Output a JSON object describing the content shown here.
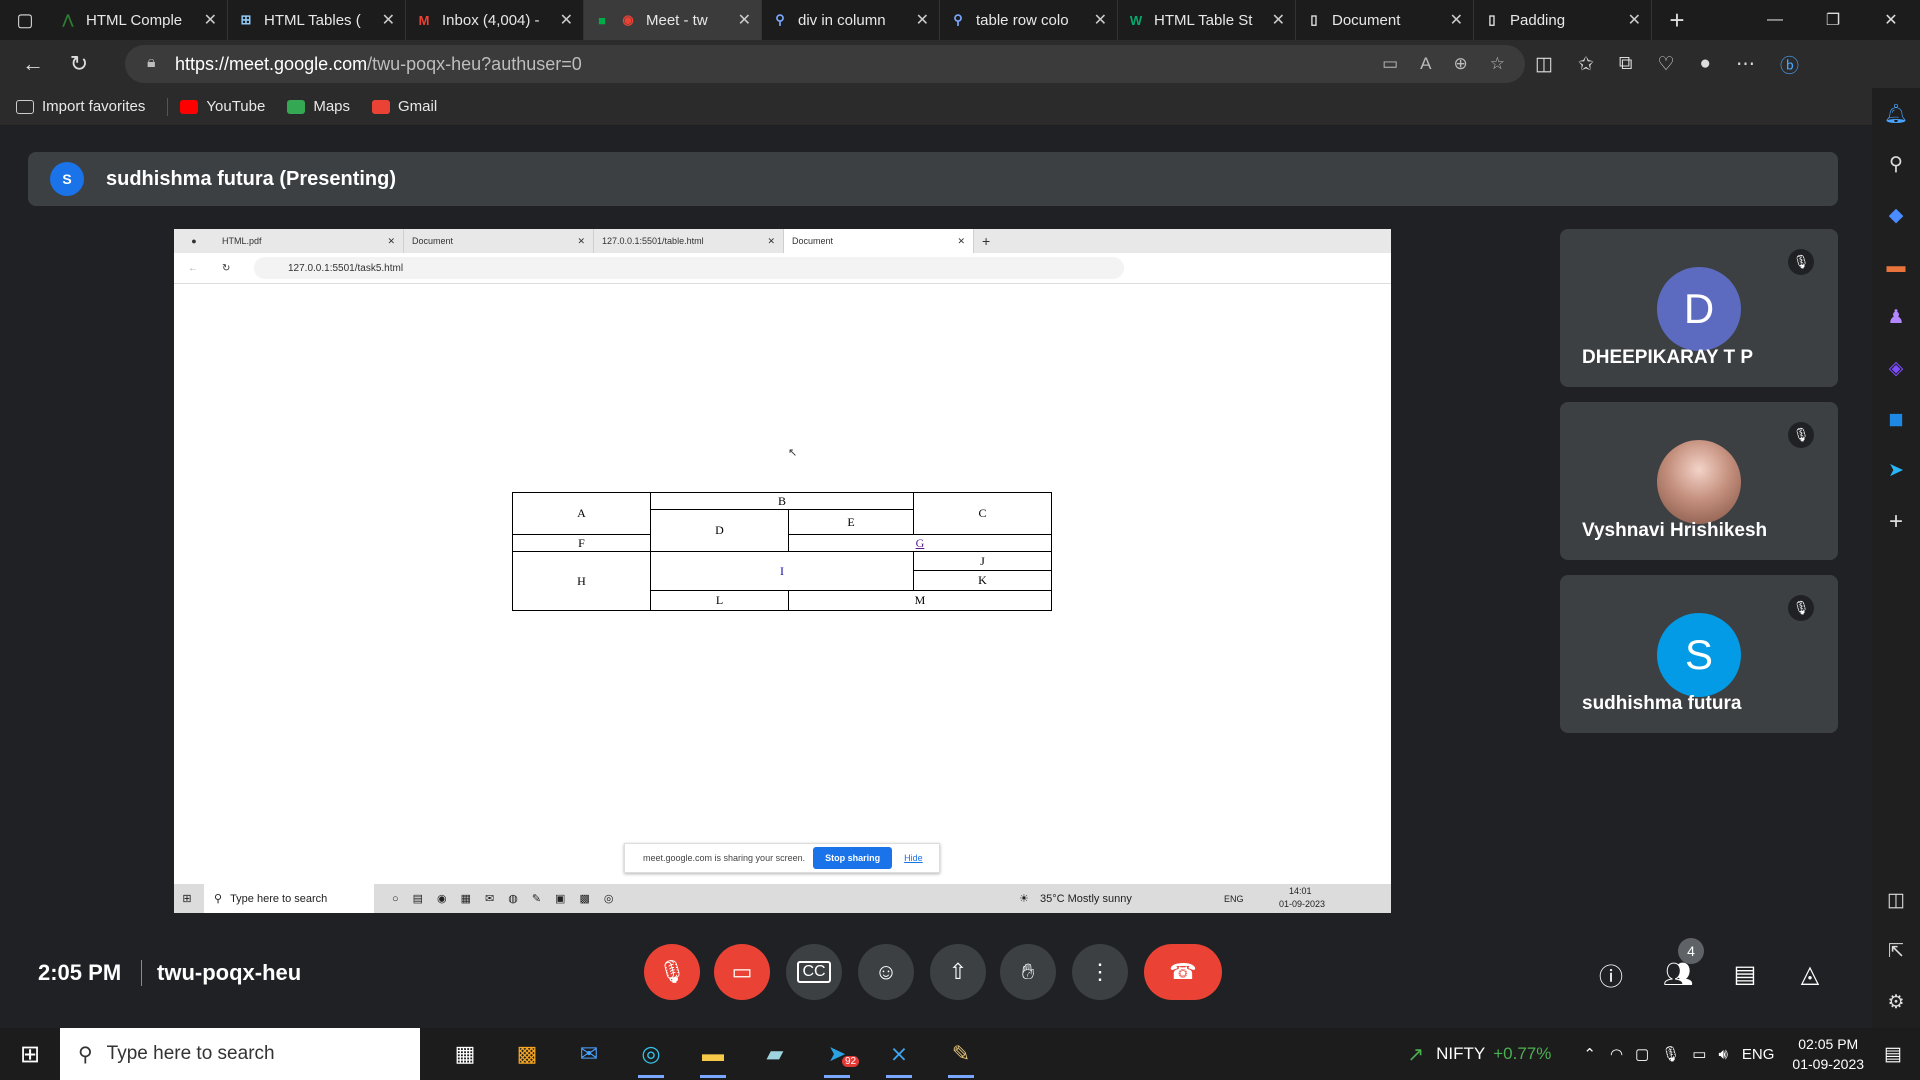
{
  "browser": {
    "tabs": [
      {
        "title": "HTML Comple",
        "icon": "document-icon"
      },
      {
        "title": "HTML Tables (",
        "icon": "tables-icon"
      },
      {
        "title": "Inbox (4,004) -",
        "icon": "gmail-icon"
      },
      {
        "title": "Meet - tw",
        "icon": "meet-icon",
        "active": true
      },
      {
        "title": "div in column",
        "icon": "search-icon"
      },
      {
        "title": "table row colo",
        "icon": "search-icon"
      },
      {
        "title": "HTML Table St",
        "icon": "w3schools-icon"
      },
      {
        "title": "Document",
        "icon": "page-icon"
      },
      {
        "title": "Padding",
        "icon": "page-icon"
      }
    ],
    "url_host": "https://meet.google.com",
    "url_path": "/twu-poqx-heu?authuser=0",
    "favorites": [
      {
        "label": "Import favorites",
        "icon": "import-icon"
      },
      {
        "label": "YouTube",
        "icon": "youtube-icon",
        "color": "#ff0000"
      },
      {
        "label": "Maps",
        "icon": "maps-icon",
        "color": "#34a853"
      },
      {
        "label": "Gmail",
        "icon": "gmail-icon",
        "color": "#ea4335"
      }
    ]
  },
  "meet": {
    "presenter_avatar": "S",
    "presenter_label": "sudhishma futura (Presenting)",
    "time": "2:05 PM",
    "code": "twu-poqx-heu",
    "participant_count": "4",
    "participants": [
      {
        "name": "DHEEPIKARAY T P",
        "initial": "D",
        "color": "#5c6bc0"
      },
      {
        "name": "Vyshnavi Hrishikesh",
        "initial": "",
        "color": "#a87a6d"
      },
      {
        "name": "sudhishma futura",
        "initial": "S",
        "color": "#039be5"
      }
    ]
  },
  "shared_screen": {
    "tabs": [
      "HTML.pdf",
      "Document",
      "127.0.0.1:5501/table.html",
      "Document"
    ],
    "url": "127.0.0.1:5501/task5.html",
    "table": {
      "A": "A",
      "B": "B",
      "C": "C",
      "D": "D",
      "E": "E",
      "F": "F",
      "G": "G",
      "H": "H",
      "I": "I",
      "J": "J",
      "K": "K",
      "L": "L",
      "M": "M"
    },
    "share_notice": "meet.google.com is sharing your screen.",
    "stop_sharing": "Stop sharing",
    "hide": "Hide",
    "taskbar_search": "Type here to search",
    "weather": "35°C  Mostly sunny",
    "lang": "ENG",
    "clock_time": "14:01",
    "clock_date": "01-09-2023"
  },
  "taskbar": {
    "search_placeholder": "Type here to search",
    "stock_label": "NIFTY",
    "stock_change": "+0.77%",
    "lang": "ENG",
    "time": "02:05 PM",
    "date": "01-09-2023",
    "telegram_badge": "92"
  }
}
